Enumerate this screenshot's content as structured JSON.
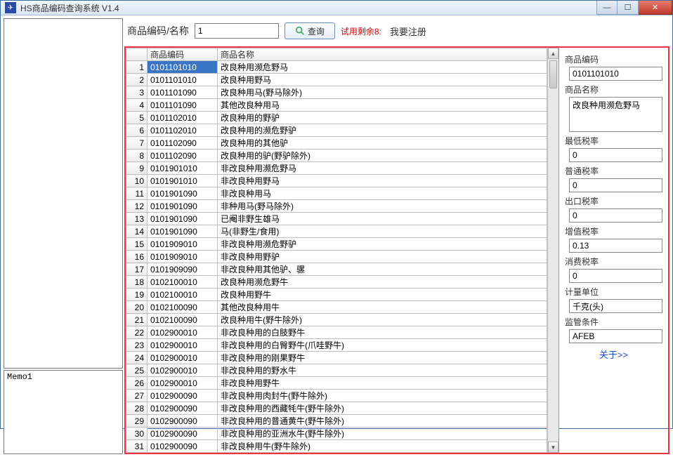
{
  "window": {
    "title": "HS商品编码查询系统 V1.4"
  },
  "memo": "Memo1",
  "search": {
    "label": "商品编码/名称",
    "value": "1",
    "button": "查询",
    "trial": "试用剩余8:",
    "register": "我要注册"
  },
  "grid": {
    "col_rownum": "",
    "col_code": "商品编码",
    "col_name": "商品名称",
    "rows": [
      {
        "n": "1",
        "code": "0101101010",
        "name": "改良种用濒危野马"
      },
      {
        "n": "2",
        "code": "0101101010",
        "name": "改良种用野马"
      },
      {
        "n": "3",
        "code": "0101101090",
        "name": "改良种用马(野马除外)"
      },
      {
        "n": "4",
        "code": "0101101090",
        "name": "其他改良种用马"
      },
      {
        "n": "5",
        "code": "0101102010",
        "name": "改良种用的野驴"
      },
      {
        "n": "6",
        "code": "0101102010",
        "name": "改良种用的濒危野驴"
      },
      {
        "n": "7",
        "code": "0101102090",
        "name": "改良种用的其他驴"
      },
      {
        "n": "8",
        "code": "0101102090",
        "name": "改良种用的驴(野驴除外)"
      },
      {
        "n": "9",
        "code": "0101901010",
        "name": "非改良种用濒危野马"
      },
      {
        "n": "10",
        "code": "0101901010",
        "name": "非改良种用野马"
      },
      {
        "n": "11",
        "code": "0101901090",
        "name": "非改良种用马"
      },
      {
        "n": "12",
        "code": "0101901090",
        "name": "非种用马(野马除外)"
      },
      {
        "n": "13",
        "code": "0101901090",
        "name": "已阉非野生雄马"
      },
      {
        "n": "14",
        "code": "0101901090",
        "name": "马(非野生/食用)"
      },
      {
        "n": "15",
        "code": "0101909010",
        "name": "非改良种用濒危野驴"
      },
      {
        "n": "16",
        "code": "0101909010",
        "name": "非改良种用野驴"
      },
      {
        "n": "17",
        "code": "0101909090",
        "name": "非改良种用其他驴、骡"
      },
      {
        "n": "18",
        "code": "0102100010",
        "name": "改良种用濒危野牛"
      },
      {
        "n": "19",
        "code": "0102100010",
        "name": "改良种用野牛"
      },
      {
        "n": "20",
        "code": "0102100090",
        "name": "其他改良种用牛"
      },
      {
        "n": "21",
        "code": "0102100090",
        "name": "改良种用牛(野牛除外)"
      },
      {
        "n": "22",
        "code": "0102900010",
        "name": "非改良种用的白肢野牛"
      },
      {
        "n": "23",
        "code": "0102900010",
        "name": "非改良种用的白臀野牛(爪哇野牛)"
      },
      {
        "n": "24",
        "code": "0102900010",
        "name": "非改良种用的刚果野牛"
      },
      {
        "n": "25",
        "code": "0102900010",
        "name": "非改良种用的野水牛"
      },
      {
        "n": "26",
        "code": "0102900010",
        "name": "非改良种用野牛"
      },
      {
        "n": "27",
        "code": "0102900090",
        "name": "非改良种用肉封牛(野牛除外)"
      },
      {
        "n": "28",
        "code": "0102900090",
        "name": "非改良种用的西藏牦牛(野牛除外)"
      },
      {
        "n": "29",
        "code": "0102900090",
        "name": "非改良种用的普通黄牛(野牛除外)"
      },
      {
        "n": "30",
        "code": "0102900090",
        "name": "非改良种用的亚洲水牛(野牛除外)"
      },
      {
        "n": "31",
        "code": "0102900090",
        "name": "非改良种用牛(野牛除外)"
      }
    ]
  },
  "detail": {
    "code_label": "商品编码",
    "code_value": "0101101010",
    "name_label": "商品名称",
    "name_value": "改良种用濒危野马",
    "minrate_label": "最低税率",
    "minrate_value": "0",
    "normalrate_label": "普通税率",
    "normalrate_value": "0",
    "exportrate_label": "出口税率",
    "exportrate_value": "0",
    "vat_label": "增值税率",
    "vat_value": "0.13",
    "consume_label": "消费税率",
    "consume_value": "0",
    "unit_label": "计量单位",
    "unit_value": "千克(头)",
    "supervise_label": "监管条件",
    "supervise_value": "AFEB",
    "about": "关于>>"
  }
}
